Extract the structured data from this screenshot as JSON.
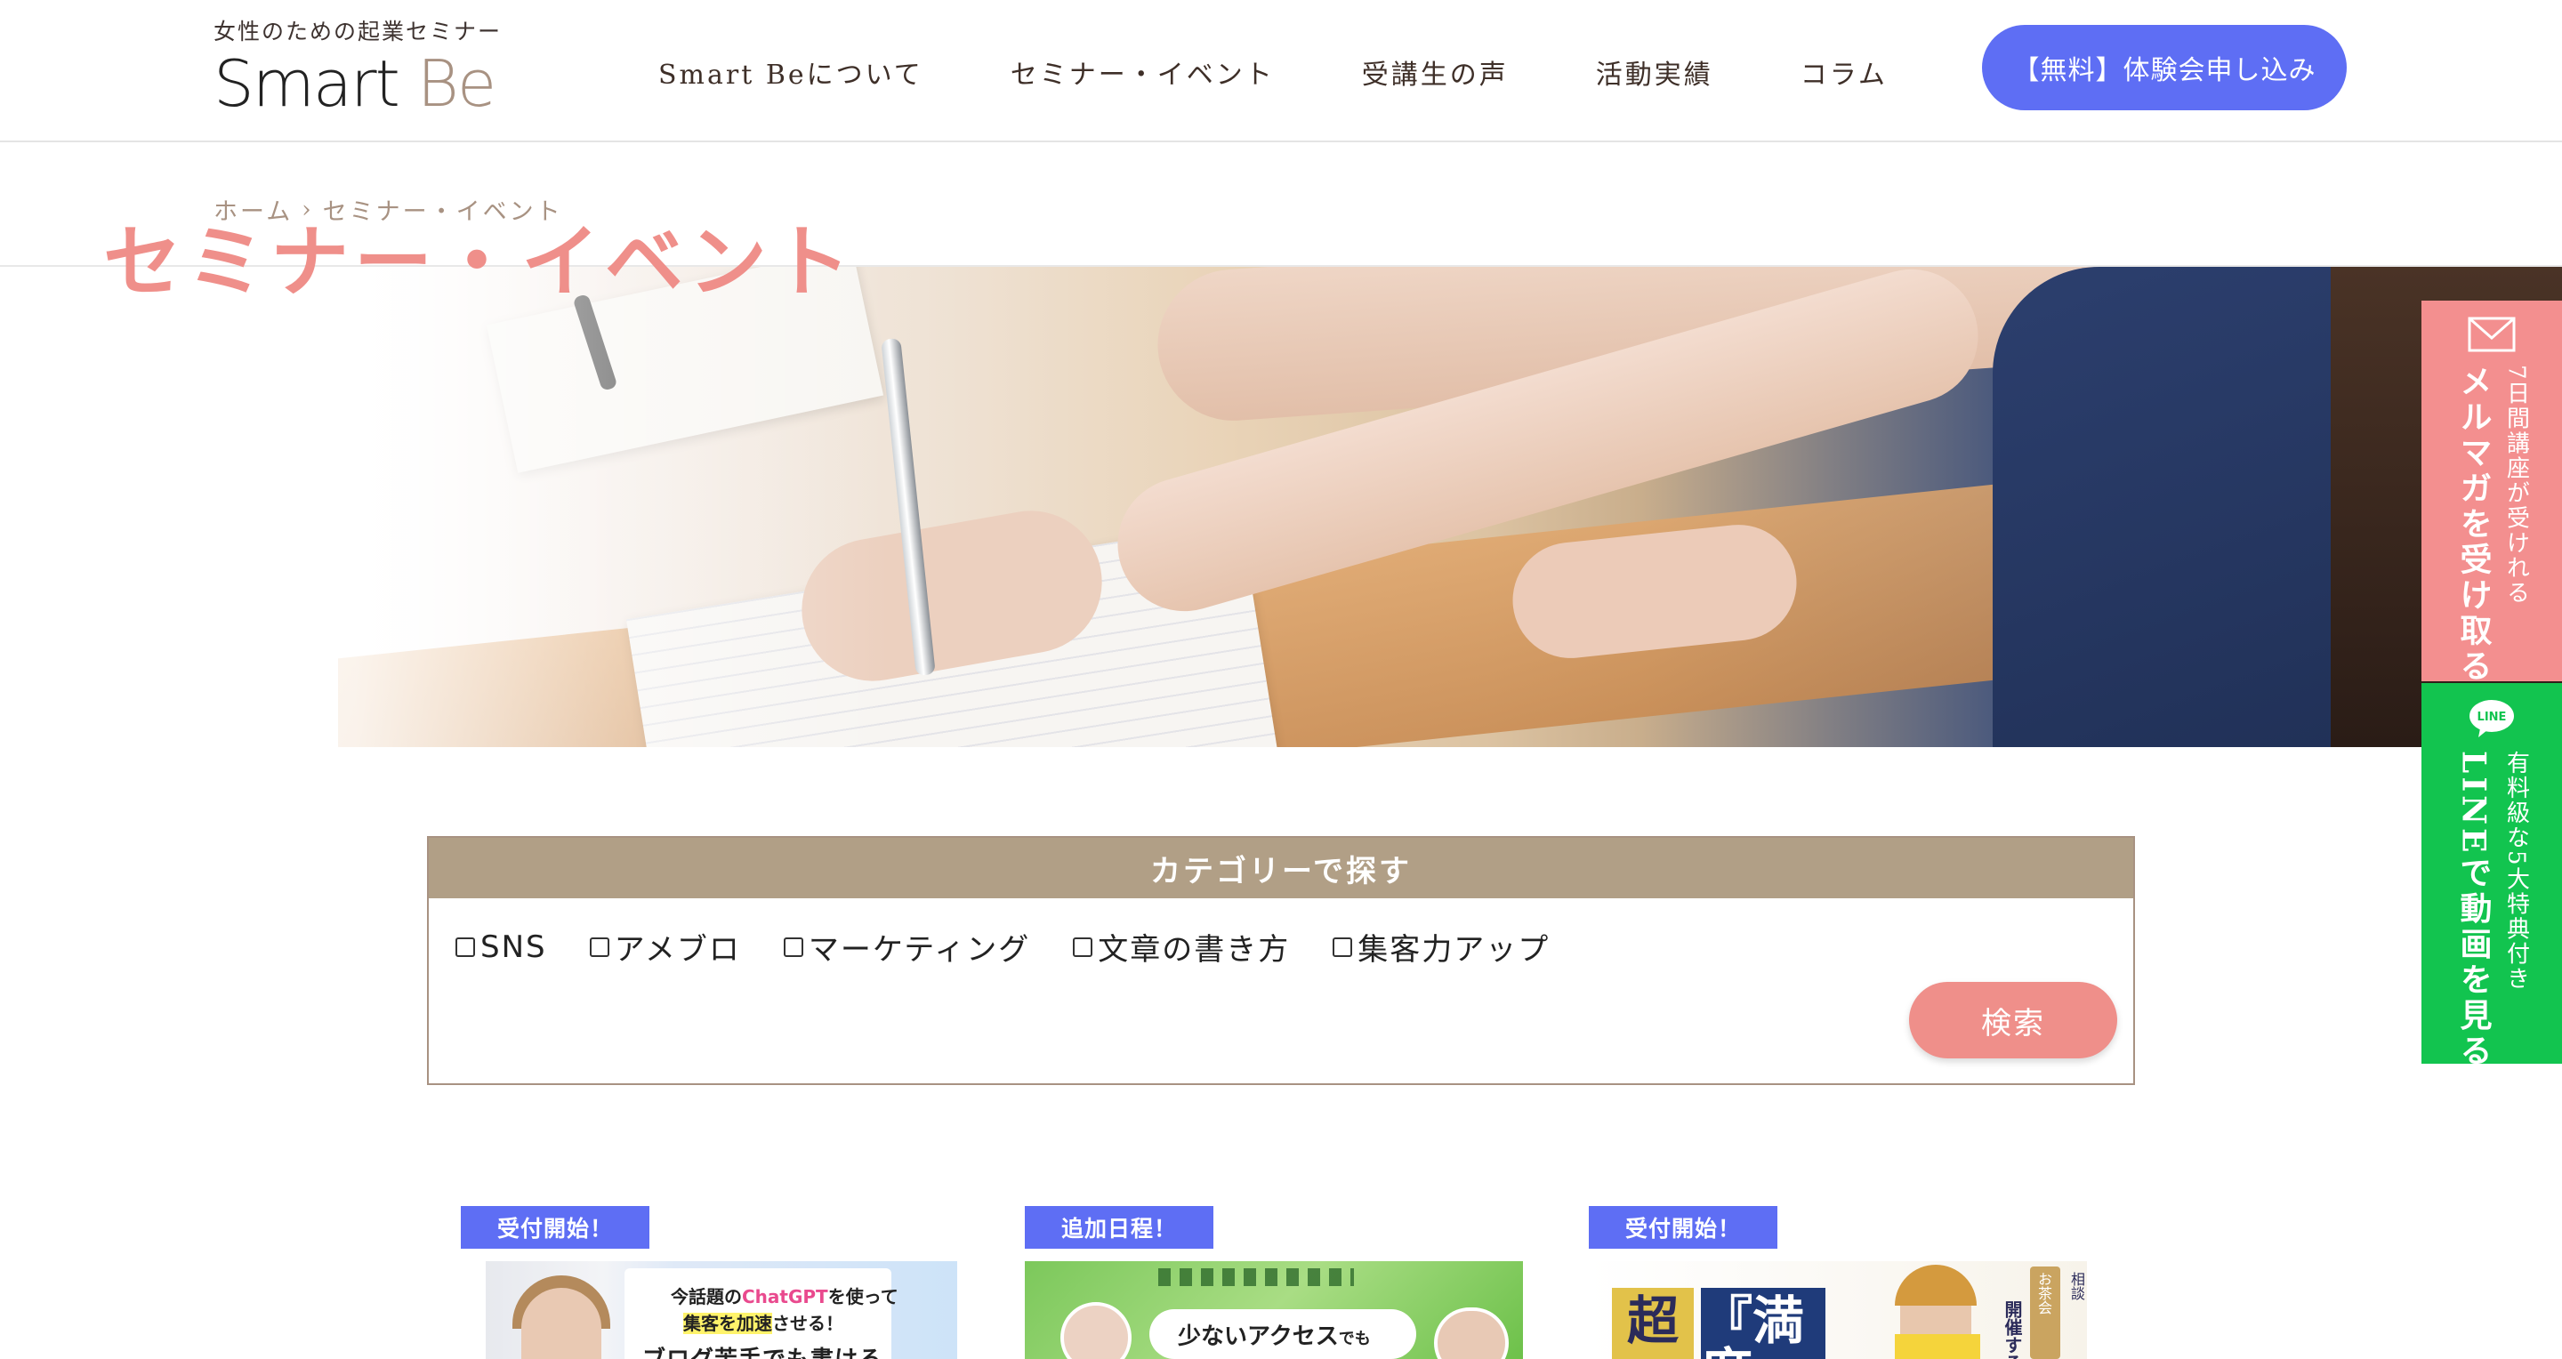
{
  "header": {
    "logo_tagline": "女性のための起業セミナー",
    "logo_text_smart": "Smart",
    "logo_text_be": "Be",
    "nav": [
      {
        "label": "Smart Beについて"
      },
      {
        "label": "セミナー・イベント"
      },
      {
        "label": "受講生の声"
      },
      {
        "label": "活動実績"
      },
      {
        "label": "コラム"
      }
    ],
    "cta_label": "【無料】体験会申し込み",
    "cta_color": "#5e6ef4"
  },
  "breadcrumb": {
    "home": "ホーム",
    "separator": "›",
    "current": "セミナー・イベント"
  },
  "hero": {
    "title": "セミナー・イベント",
    "title_color": "#ef8f8a"
  },
  "side_tabs": {
    "mail": {
      "icon": "mail-icon",
      "subtitle": "7日間講座が受けれる",
      "title": "メルマガを受け取る",
      "color": "#f38f8f"
    },
    "line": {
      "icon": "line-icon",
      "icon_label": "LINE",
      "subtitle": "有料級な5大特典付き",
      "title": "LINEで動画を見る",
      "color": "#12c44f"
    }
  },
  "category_search": {
    "heading": "カテゴリーで探す",
    "options": [
      {
        "label": "SNS",
        "checked": false
      },
      {
        "label": "アメブロ",
        "checked": false
      },
      {
        "label": "マーケティング",
        "checked": false
      },
      {
        "label": "文章の書き方",
        "checked": false
      },
      {
        "label": "集客力アップ",
        "checked": false
      }
    ],
    "search_button": "検索",
    "header_color": "#b19f86",
    "button_color": "#ef8f8a"
  },
  "cards": [
    {
      "badge": "受付開始！",
      "thumb_line1_a": "今話題の",
      "thumb_line1_b": "ChatGPT",
      "thumb_line1_c": "を使って",
      "thumb_line2_a": "集客を加速",
      "thumb_line2_b": "させる！",
      "thumb_line3": "ブログ苦手でも書ける"
    },
    {
      "badge": "追加日程！",
      "thumb_text_a": "少ないアクセス",
      "thumb_text_b": "でも"
    },
    {
      "badge": "受付開始！",
      "thumb_kanji1": "超",
      "thumb_kanji2": "『満席",
      "thumb_vertical": "開催するため",
      "thumb_tag1": "お茶会",
      "thumb_tag2": "相談"
    }
  ],
  "badge_color": "#5e6ef4"
}
